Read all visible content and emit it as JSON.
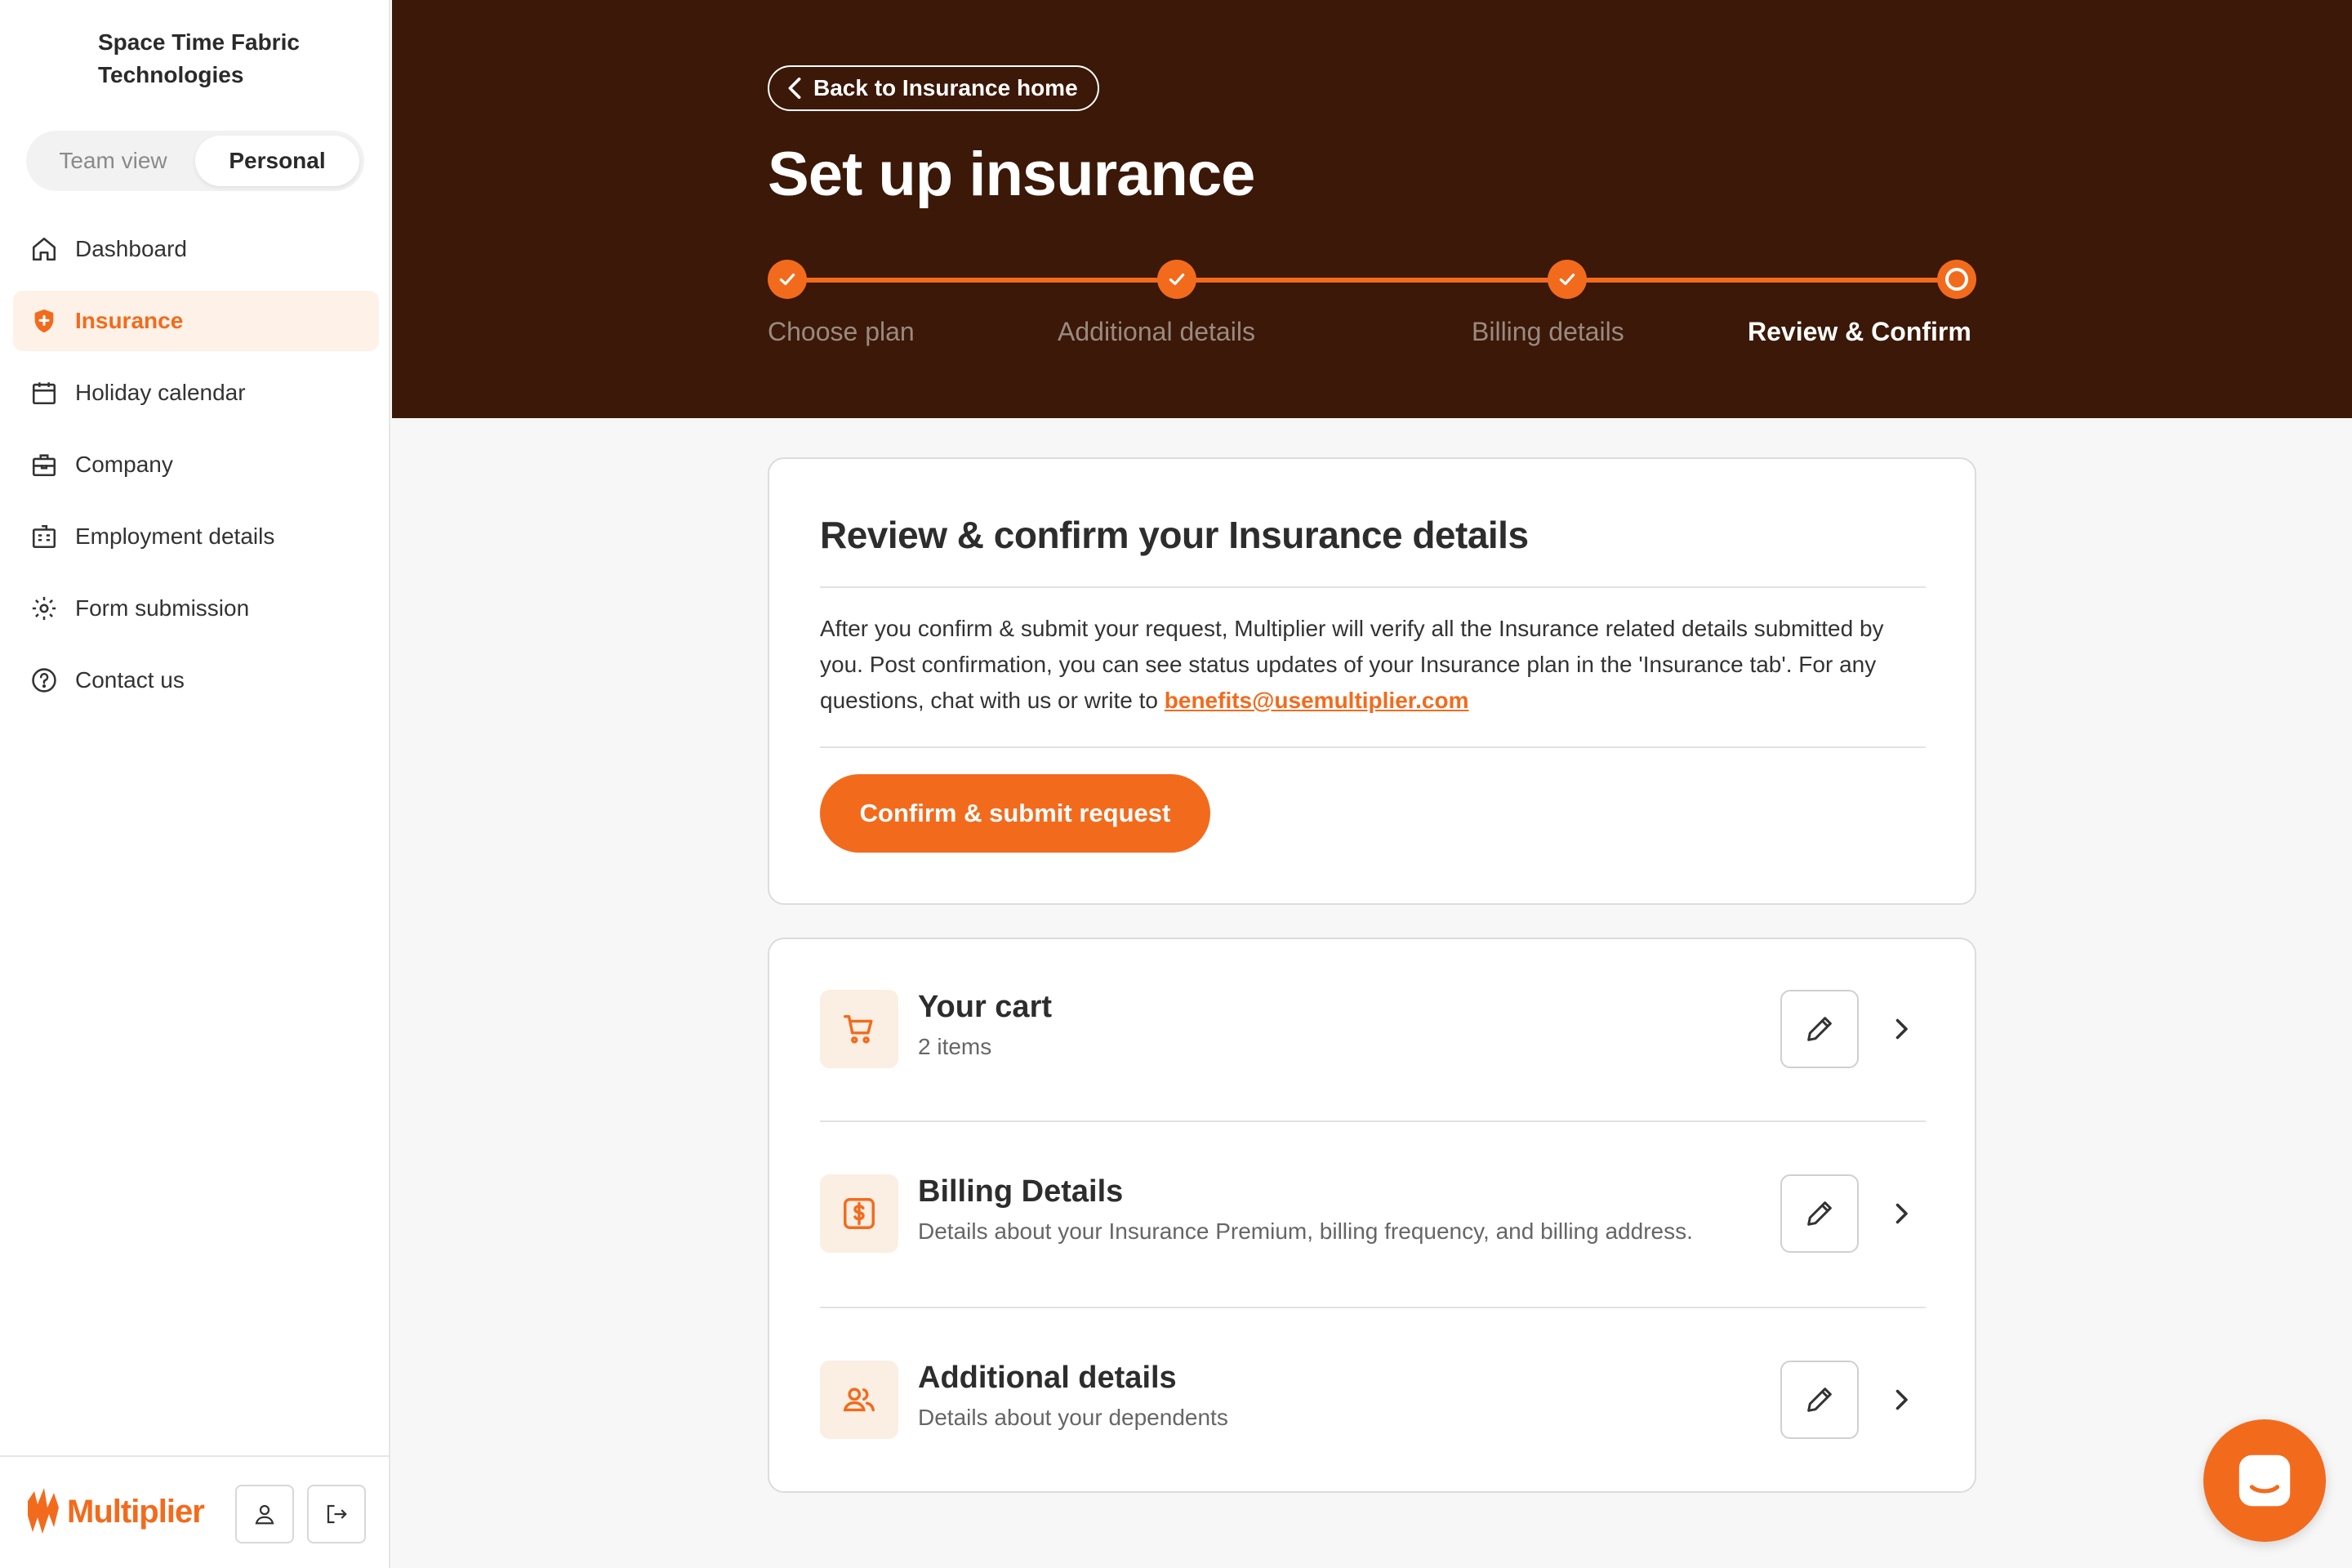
{
  "sidebar": {
    "org_name": "Space Time Fabric Technologies",
    "view_toggle": [
      "Team view",
      "Personal"
    ],
    "active_view": "Personal",
    "nav_items": [
      {
        "label": "Dashboard",
        "icon": "home-icon"
      },
      {
        "label": "Insurance",
        "icon": "shield-icon",
        "active": true
      },
      {
        "label": "Holiday calendar",
        "icon": "calendar-icon"
      },
      {
        "label": "Company",
        "icon": "briefcase-icon"
      },
      {
        "label": "Employment details",
        "icon": "building-icon"
      },
      {
        "label": "Form submission",
        "icon": "gear-icon"
      },
      {
        "label": "Contact us",
        "icon": "help-circle-icon"
      }
    ],
    "brand": "Multiplier",
    "footer_icons": [
      "profile-icon",
      "logout-icon"
    ]
  },
  "header": {
    "back_label": "Back to Insurance home",
    "title": "Set up insurance",
    "steps": [
      {
        "label": "Choose plan",
        "status": "done"
      },
      {
        "label": "Additional details",
        "status": "done"
      },
      {
        "label": "Billing details",
        "status": "done"
      },
      {
        "label": "Review & Confirm",
        "status": "current"
      }
    ]
  },
  "review": {
    "title": "Review & confirm your Insurance details",
    "body": "After you confirm & submit your request, Multiplier will verify all the Insurance related details submitted by you. Post confirmation, you can see status updates of your Insurance plan in the 'Insurance tab'. For any questions, chat with us or write to",
    "email": "benefits@usemultiplier.com",
    "submit_label": "Confirm & submit request"
  },
  "sections": [
    {
      "title": "Your cart",
      "subtitle": "2 items",
      "icon": "cart-icon"
    },
    {
      "title": "Billing Details",
      "subtitle": "Details about your Insurance Premium, billing frequency, and billing address.",
      "icon": "dollar-icon"
    },
    {
      "title": "Additional details",
      "subtitle": "Details about your dependents",
      "icon": "users-icon"
    }
  ],
  "colors": {
    "accent": "#f26b1d",
    "header_bg": "#3b1807",
    "icon_tile_bg": "#fbeee2"
  }
}
